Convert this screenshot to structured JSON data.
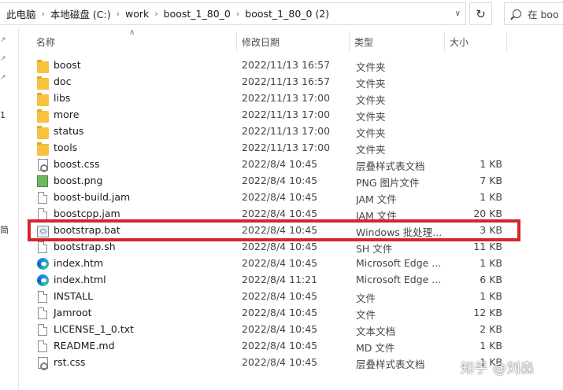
{
  "breadcrumb": [
    "此电脑",
    "本地磁盘 (C:)",
    "work",
    "boost_1_80_0",
    "boost_1_80_0 (2)"
  ],
  "search": {
    "placeholder": "在 boo"
  },
  "nav_fragments": [
    "1",
    "简"
  ],
  "columns": {
    "name": "名称",
    "modified": "修改日期",
    "type": "类型",
    "size": "大小"
  },
  "files": [
    {
      "name": "boost",
      "modified": "2022/11/13 16:57",
      "type": "文件夹",
      "size": "",
      "icon": "folder-icon"
    },
    {
      "name": "doc",
      "modified": "2022/11/13 16:57",
      "type": "文件夹",
      "size": "",
      "icon": "folder-icon"
    },
    {
      "name": "libs",
      "modified": "2022/11/13 17:00",
      "type": "文件夹",
      "size": "",
      "icon": "folder-icon"
    },
    {
      "name": "more",
      "modified": "2022/11/13 17:00",
      "type": "文件夹",
      "size": "",
      "icon": "folder-icon"
    },
    {
      "name": "status",
      "modified": "2022/11/13 17:00",
      "type": "文件夹",
      "size": "",
      "icon": "folder-icon"
    },
    {
      "name": "tools",
      "modified": "2022/11/13 17:00",
      "type": "文件夹",
      "size": "",
      "icon": "folder-icon"
    },
    {
      "name": "boost.css",
      "modified": "2022/8/4 10:45",
      "type": "层叠样式表文档",
      "size": "1 KB",
      "icon": "css-file-icon"
    },
    {
      "name": "boost.png",
      "modified": "2022/8/4 10:45",
      "type": "PNG 图片文件",
      "size": "7 KB",
      "icon": "png-file-icon"
    },
    {
      "name": "boost-build.jam",
      "modified": "2022/8/4 10:45",
      "type": "JAM 文件",
      "size": "1 KB",
      "icon": "file-icon"
    },
    {
      "name": "boostcpp.jam",
      "modified": "2022/8/4 10:45",
      "type": "JAM 文件",
      "size": "20 KB",
      "icon": "file-icon"
    },
    {
      "name": "bootstrap.bat",
      "modified": "2022/8/4 10:45",
      "type": "Windows 批处理...",
      "size": "3 KB",
      "icon": "batch-file-icon"
    },
    {
      "name": "bootstrap.sh",
      "modified": "2022/8/4 10:45",
      "type": "SH 文件",
      "size": "11 KB",
      "icon": "file-icon"
    },
    {
      "name": "index.htm",
      "modified": "2022/8/4 10:45",
      "type": "Microsoft Edge ...",
      "size": "1 KB",
      "icon": "edge-icon"
    },
    {
      "name": "index.html",
      "modified": "2022/8/4 11:21",
      "type": "Microsoft Edge ...",
      "size": "6 KB",
      "icon": "edge-icon"
    },
    {
      "name": "INSTALL",
      "modified": "2022/8/4 10:45",
      "type": "文件",
      "size": "1 KB",
      "icon": "file-icon"
    },
    {
      "name": "Jamroot",
      "modified": "2022/8/4 10:45",
      "type": "文件",
      "size": "12 KB",
      "icon": "file-icon"
    },
    {
      "name": "LICENSE_1_0.txt",
      "modified": "2022/8/4 10:45",
      "type": "文本文档",
      "size": "2 KB",
      "icon": "file-icon"
    },
    {
      "name": "README.md",
      "modified": "2022/8/4 10:45",
      "type": "MD 文件",
      "size": "1 KB",
      "icon": "file-icon"
    },
    {
      "name": "rst.css",
      "modified": "2022/8/4 10:45",
      "type": "层叠样式表文档",
      "size": "1 KB",
      "icon": "css-file-icon"
    }
  ],
  "highlight_color": "#d7232a",
  "watermark": "知乎 @刘森"
}
